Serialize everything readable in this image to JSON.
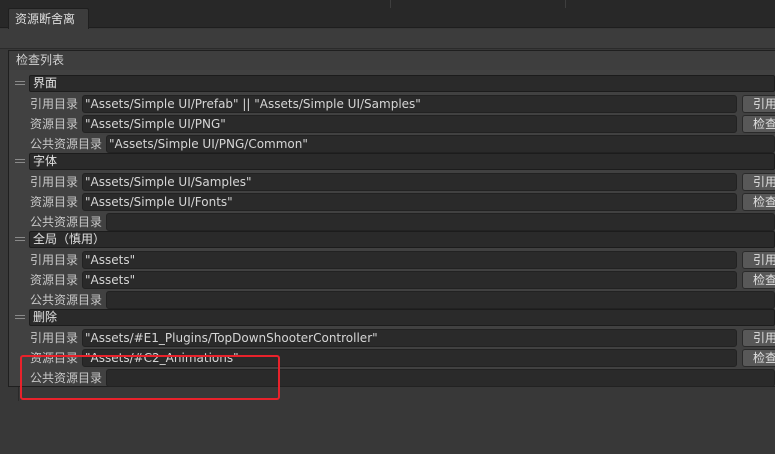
{
  "window": {
    "tab_title": "资源断舍离"
  },
  "section_title": "检查列表",
  "groups": [
    {
      "name": "界面",
      "rows": [
        {
          "label": "引用目录",
          "value": "\"Assets/Simple UI/Prefab\" || \"Assets/Simple UI/Samples\"",
          "button": "引用"
        },
        {
          "label": "资源目录",
          "value": "\"Assets/Simple UI/PNG\"",
          "button": "检查"
        },
        {
          "label": "公共资源目录",
          "value": "\"Assets/Simple UI/PNG/Common\""
        }
      ]
    },
    {
      "name": "字体",
      "rows": [
        {
          "label": "引用目录",
          "value": "\"Assets/Simple UI/Samples\"",
          "button": "引用"
        },
        {
          "label": "资源目录",
          "value": "\"Assets/Simple UI/Fonts\"",
          "button": "检查"
        },
        {
          "label": "公共资源目录",
          "value": ""
        }
      ]
    },
    {
      "name": "全局（慎用）",
      "rows": [
        {
          "label": "引用目录",
          "value": "\"Assets\"",
          "button": "引用"
        },
        {
          "label": "资源目录",
          "value": "\"Assets\"",
          "button": "检查"
        },
        {
          "label": "公共资源目录",
          "value": ""
        }
      ]
    },
    {
      "name": "删除",
      "rows": [
        {
          "label": "引用目录",
          "value": "\"Assets/#E1_Plugins/TopDownShooterController\"",
          "button": "引用"
        },
        {
          "label": "资源目录",
          "value": "\"Assets/#C2_Animations\"",
          "button": "检查"
        },
        {
          "label": "公共资源目录",
          "value": ""
        }
      ]
    }
  ],
  "colors": {
    "highlight": "#e8222b",
    "background": "#383838",
    "field": "#2a2a2a"
  }
}
